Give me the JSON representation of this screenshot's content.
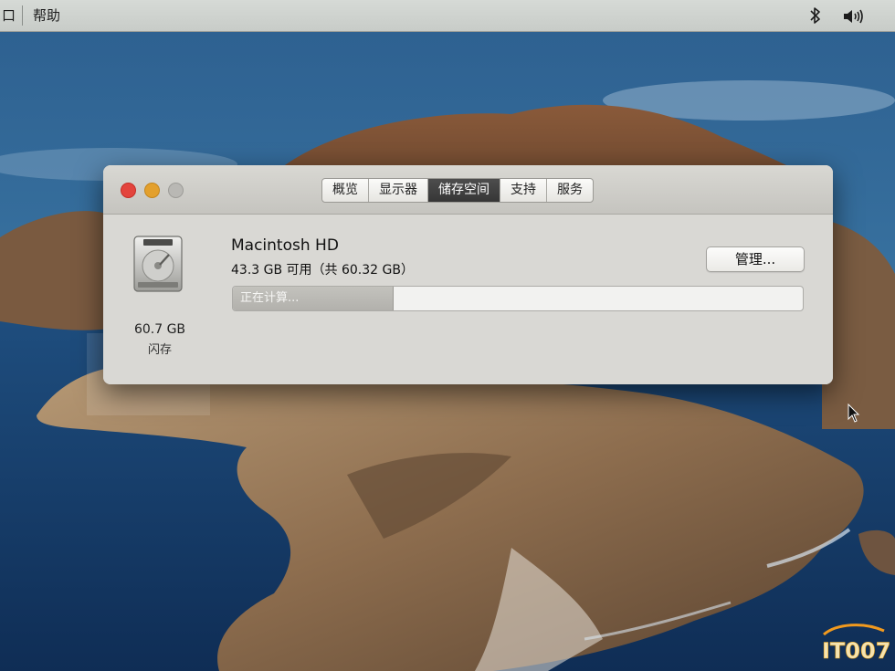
{
  "menubar": {
    "items": [
      "口",
      "帮助"
    ],
    "status_icons": [
      "bluetooth-icon",
      "volume-icon"
    ]
  },
  "window": {
    "title_buttons": [
      "close",
      "minimize",
      "zoom"
    ],
    "tabs": [
      {
        "label": "概览",
        "selected": false
      },
      {
        "label": "显示器",
        "selected": false
      },
      {
        "label": "储存空间",
        "selected": true
      },
      {
        "label": "支持",
        "selected": false
      },
      {
        "label": "服务",
        "selected": false
      }
    ],
    "storage": {
      "drive_size": "60.7 GB",
      "drive_kind": "闪存",
      "volume_name": "Macintosh HD",
      "available": "43.3 GB 可用（共 60.32 GB）",
      "usage_label": "正在计算...",
      "used_fraction": 0.28,
      "manage_label": "管理..."
    }
  },
  "watermark": "IT007",
  "colors": {
    "close": "#e3443d",
    "minimize": "#e3a02d",
    "selected_tab": "#3d3d3d",
    "watermark_orange": "#f29a1e"
  }
}
